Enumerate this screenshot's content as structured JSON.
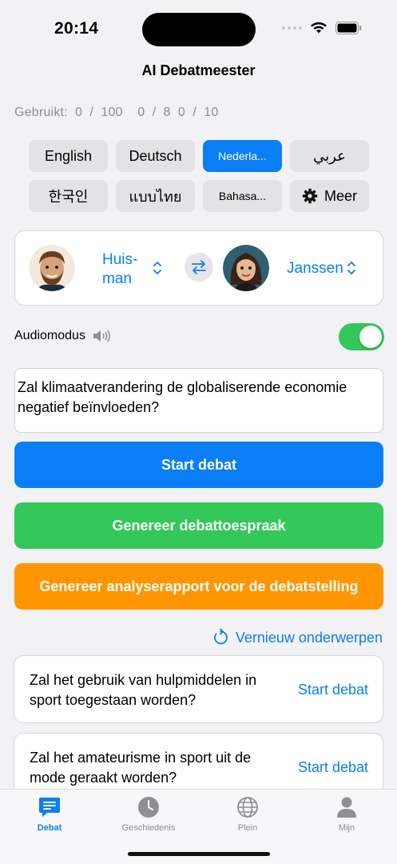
{
  "status": {
    "time": "20:14"
  },
  "nav": {
    "title": "AI Debatmeester"
  },
  "usage": {
    "label": "Gebruikt:",
    "counts": "0  /  100    0  /  8  0  /  10"
  },
  "languages": [
    {
      "label": "English"
    },
    {
      "label": "Deutsch"
    },
    {
      "label": "Nederla..."
    },
    {
      "label": "عربي"
    },
    {
      "label": "한국인"
    },
    {
      "label": "แบบไทย"
    },
    {
      "label": "Bahasa..."
    },
    {
      "label": "Meer"
    }
  ],
  "debaters": {
    "left_name": "Huis-\nman",
    "right_name": "Janssen"
  },
  "audio": {
    "label": "Audiomodus",
    "enabled": true
  },
  "topic": {
    "text": "Zal klimaatverandering de globaliserende economie negatief beïnvloeden?"
  },
  "actions": {
    "start": "Start debat",
    "speech": "Genereer debattoespraak",
    "report": "Genereer analyserapport voor de debatstelling"
  },
  "refresh_label": "Vernieuw onderwerpen",
  "suggested_topics": [
    {
      "text": "Zal het gebruik van hulpmiddelen in sport toegestaan worden?",
      "action": "Start debat"
    },
    {
      "text": "Zal het amateurisme in sport uit de mode geraakt worden?",
      "action": "Start debat"
    }
  ],
  "tabs": [
    {
      "label": "Debat",
      "icon": "chat-bubble-icon",
      "active": true
    },
    {
      "label": "Geschiedenis",
      "icon": "clock-icon",
      "active": false
    },
    {
      "label": "Plein",
      "icon": "globe-icon",
      "active": false
    },
    {
      "label": "Mijn",
      "icon": "person-icon",
      "active": false
    }
  ],
  "colors": {
    "accent": "#0a7ff5",
    "start": "#0a7ff5",
    "speech": "#34c759",
    "report": "#ff9500"
  }
}
